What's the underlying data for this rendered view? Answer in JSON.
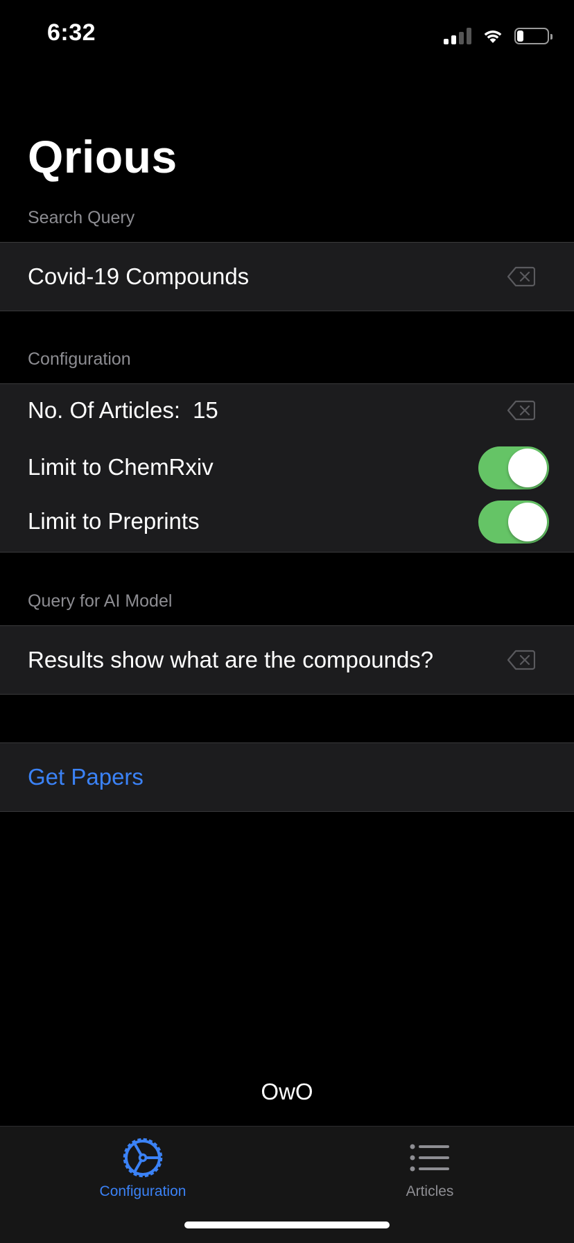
{
  "status_bar": {
    "time": "6:32"
  },
  "title": "Qrious",
  "search_section": {
    "header": "Search Query",
    "value": "Covid-19 Compounds"
  },
  "config_section": {
    "header": "Configuration",
    "articles_label": "No. Of Articles:",
    "articles_value": "15",
    "chemrxiv_label": "Limit to ChemRxiv",
    "chemrxiv_on": true,
    "preprints_label": "Limit to Preprints",
    "preprints_on": true
  },
  "ai_section": {
    "header": "Query for AI Model",
    "value": "Results show what are the compounds?"
  },
  "action": {
    "get_papers_label": "Get Papers"
  },
  "footer_text": "OwO",
  "tab_bar": {
    "tabs": [
      {
        "label": "Configuration",
        "icon": "gear-icon",
        "active": true
      },
      {
        "label": "Articles",
        "icon": "list-icon",
        "active": false
      }
    ]
  },
  "colors": {
    "accent": "#3b82f6",
    "toggle_on": "#65c466",
    "background": "#000000",
    "cell": "#1c1c1e",
    "secondary_text": "#8d8d92"
  }
}
